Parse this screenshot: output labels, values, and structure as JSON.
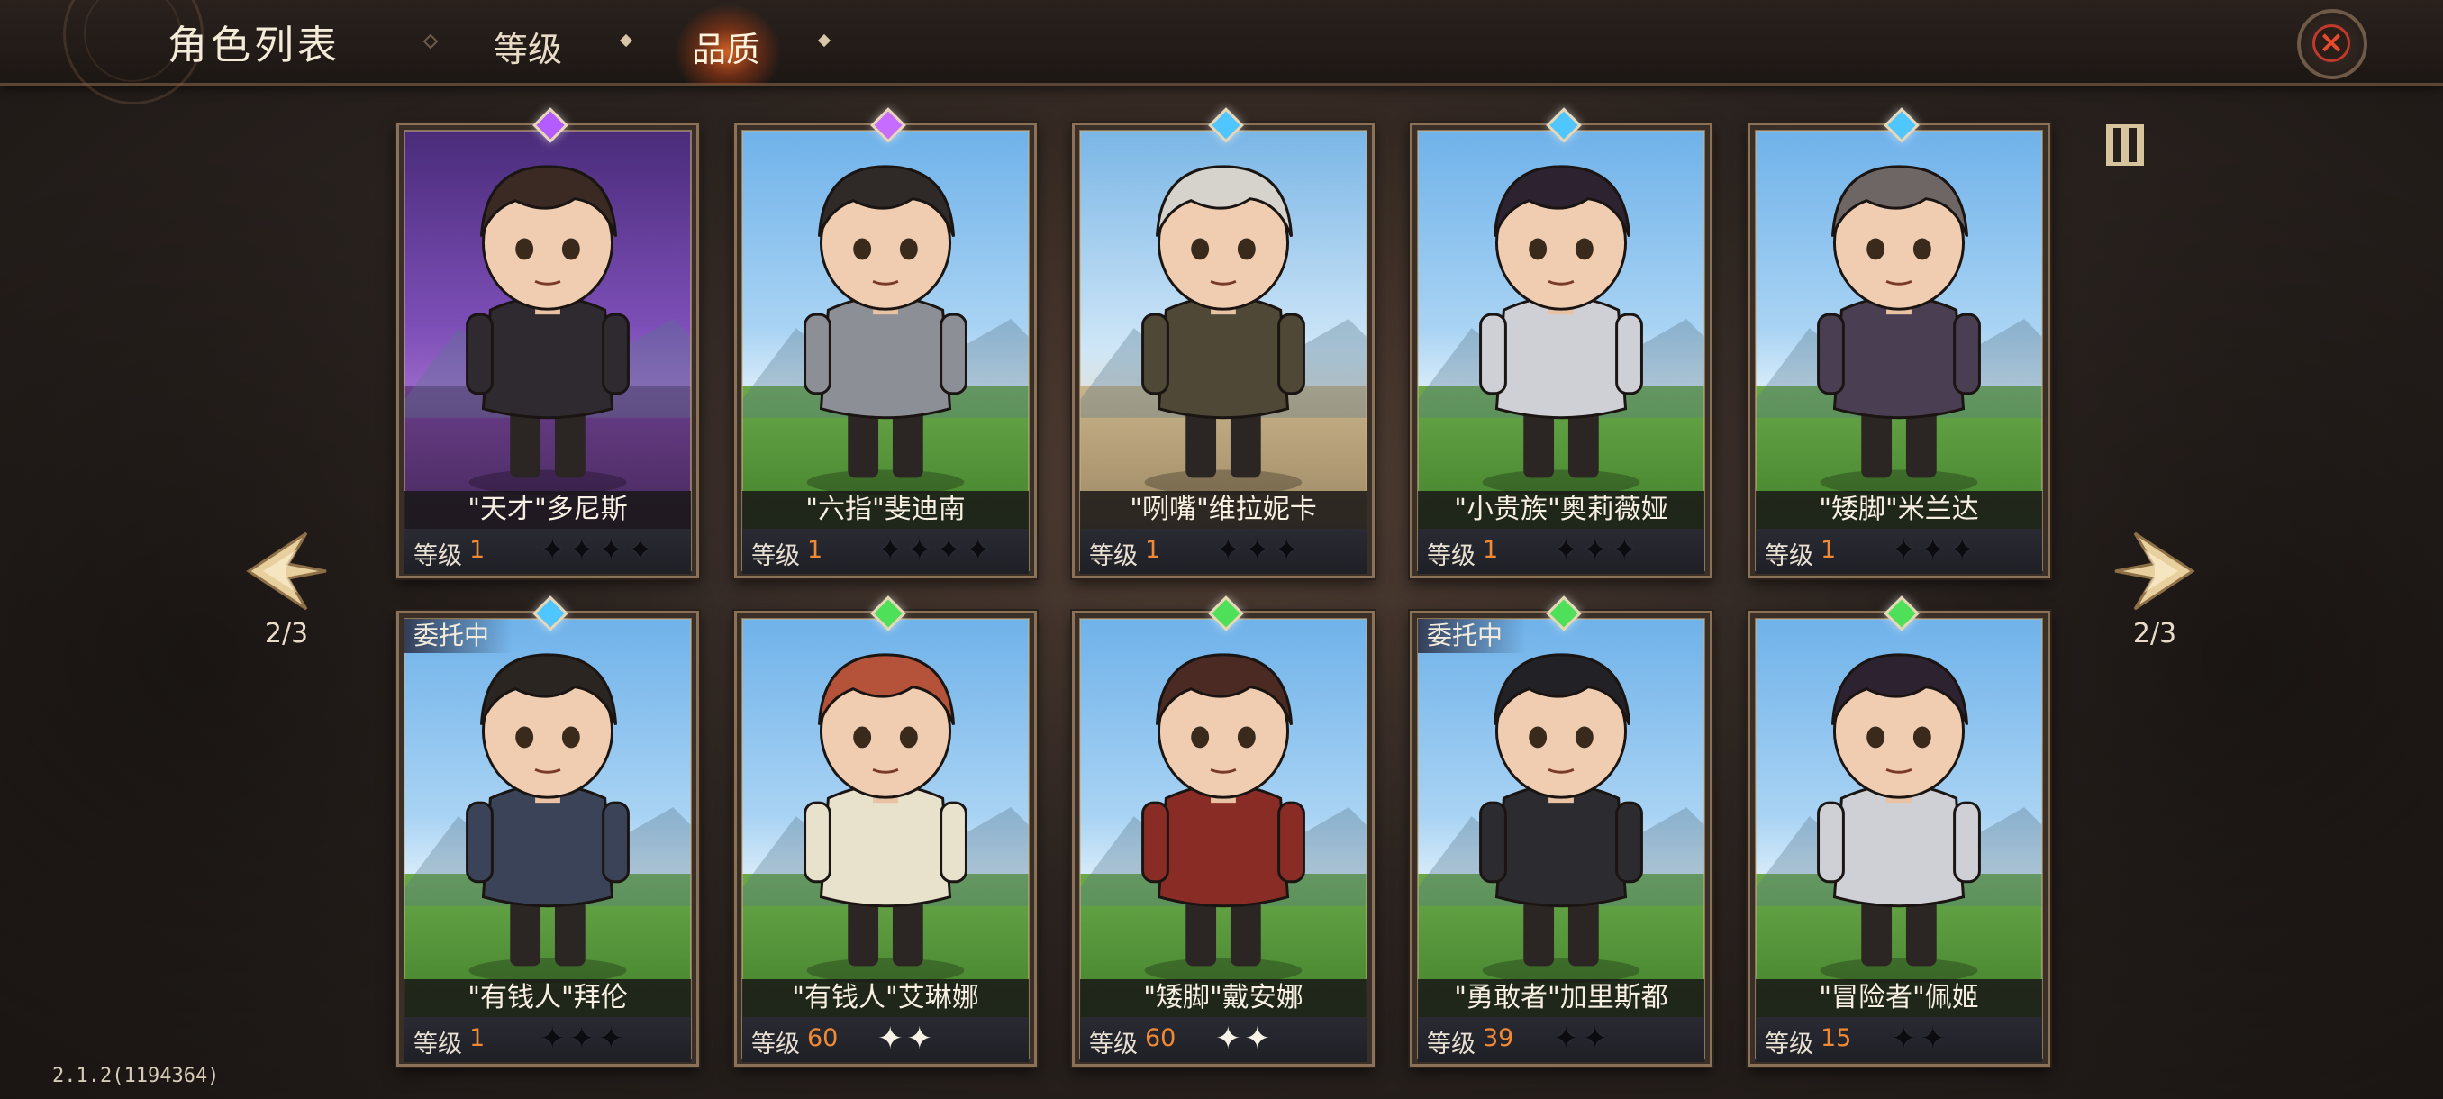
{
  "header": {
    "title": "角色列表",
    "tabs": [
      {
        "label": "等级",
        "active": false
      },
      {
        "label": "品质",
        "active": true
      }
    ],
    "close_icon": "close-icon"
  },
  "pager": {
    "left": "2/3",
    "right": "2/3"
  },
  "cards": [
    {
      "name": "\"天才\"多尼斯",
      "level_label": "等级",
      "level": "1",
      "stars_on": 0,
      "stars_total": 4,
      "gem": "#b45cff",
      "badge": "",
      "theme": "purple",
      "hair": "#3b2a24",
      "outfit": "#2e2a30"
    },
    {
      "name": "\"六指\"斐迪南",
      "level_label": "等级",
      "level": "1",
      "stars_on": 0,
      "stars_total": 4,
      "gem": "#c66cff",
      "badge": "",
      "theme": "meadow",
      "hair": "#2f2a28",
      "outfit": "#8d8f96"
    },
    {
      "name": "\"咧嘴\"维拉妮卡",
      "level_label": "等级",
      "level": "1",
      "stars_on": 0,
      "stars_total": 3,
      "gem": "#4fc6ff",
      "badge": "",
      "theme": "desert",
      "hair": "#d6d2cc",
      "outfit": "#4f4836"
    },
    {
      "name": "\"小贵族\"奥莉薇娅",
      "level_label": "等级",
      "level": "1",
      "stars_on": 0,
      "stars_total": 3,
      "gem": "#4fc6ff",
      "badge": "",
      "theme": "meadow",
      "hair": "#2d2330",
      "outfit": "#cfcfd6"
    },
    {
      "name": "\"矮脚\"米兰达",
      "level_label": "等级",
      "level": "1",
      "stars_on": 0,
      "stars_total": 3,
      "gem": "#4fc6ff",
      "badge": "",
      "theme": "meadow",
      "hair": "#6e6664",
      "outfit": "#4a3e52"
    },
    {
      "name": "\"有钱人\"拜伦",
      "level_label": "等级",
      "level": "1",
      "stars_on": 0,
      "stars_total": 3,
      "gem": "#4fc6ff",
      "badge": "委托中",
      "theme": "meadow",
      "hair": "#2a2520",
      "outfit": "#3a4358"
    },
    {
      "name": "\"有钱人\"艾琳娜",
      "level_label": "等级",
      "level": "60",
      "stars_on": 2,
      "stars_total": 2,
      "gem": "#4fe05a",
      "badge": "",
      "theme": "meadow",
      "hair": "#b4523a",
      "outfit": "#e8e2cc"
    },
    {
      "name": "\"矮脚\"戴安娜",
      "level_label": "等级",
      "level": "60",
      "stars_on": 2,
      "stars_total": 2,
      "gem": "#4fe05a",
      "badge": "",
      "theme": "meadow",
      "hair": "#4a2a22",
      "outfit": "#8a2c26"
    },
    {
      "name": "\"勇敢者\"加里斯都",
      "level_label": "等级",
      "level": "39",
      "stars_on": 0,
      "stars_total": 2,
      "gem": "#4fe05a",
      "badge": "委托中",
      "theme": "meadow",
      "hair": "#222226",
      "outfit": "#2c2c30"
    },
    {
      "name": "\"冒险者\"佩姬",
      "level_label": "等级",
      "level": "15",
      "stars_on": 0,
      "stars_total": 2,
      "gem": "#4fe05a",
      "badge": "",
      "theme": "meadow",
      "hair": "#2d2330",
      "outfit": "#cfcfd6"
    }
  ],
  "version": "2.1.2(1194364)"
}
